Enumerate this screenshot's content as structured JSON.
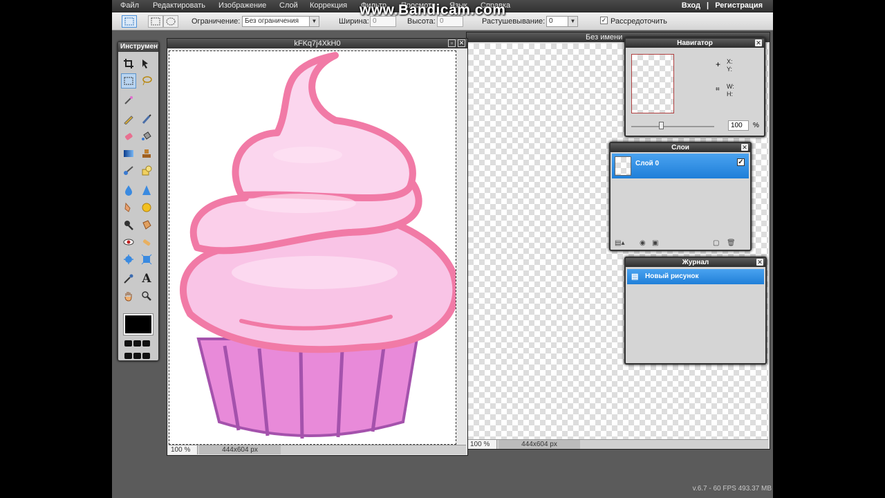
{
  "menubar": {
    "items": [
      "Файл",
      "Редактировать",
      "Изображение",
      "Слой",
      "Коррекция",
      "Фильтр",
      "Просмотр",
      "Язык",
      "Справка"
    ],
    "login": "Вход",
    "separator": "|",
    "register": "Регистрация"
  },
  "watermark": "www.Bandicam.com",
  "options": {
    "constraint_label": "Ограничение:",
    "constraint_value": "Без ограничения",
    "width_label": "Ширина:",
    "width_value": "0",
    "height_label": "Высота:",
    "height_value": "0",
    "feather_label": "Растушевывание:",
    "feather_value": "0",
    "antialias_label": "Рассредоточить",
    "antialias_checked": "✓"
  },
  "toolbox": {
    "title": "Инструменты"
  },
  "doc1": {
    "title": "kFKq7j4XkH0",
    "zoom": "100 %",
    "size": "444x604 px"
  },
  "doc2": {
    "title": "Без имени",
    "zoom": "100 %",
    "size": "444x604 px"
  },
  "navigator": {
    "title": "Навигатор",
    "x_label": "X:",
    "y_label": "Y:",
    "w_label": "W:",
    "h_label": "H:",
    "zoom_value": "100",
    "zoom_unit": "%"
  },
  "layers": {
    "title": "Слои",
    "layer_name": "Слой 0",
    "visible_check": "✓"
  },
  "history": {
    "title": "Журнал",
    "entry": "Новый рисунок"
  },
  "footer": "v.6.7 - 60 FPS 493.37 MB",
  "colors": {
    "frosting": "#f9c4e6",
    "frosting_outline": "#f17aa6",
    "cup": "#e88ad9",
    "cup_stripes": "#a452ac",
    "selection_blue": "#2a8ae0"
  }
}
